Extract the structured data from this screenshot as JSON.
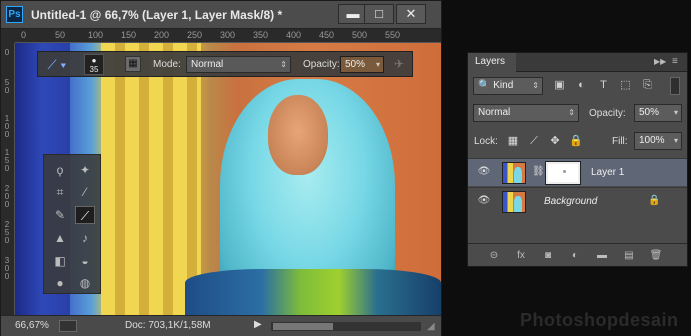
{
  "document": {
    "title": "Untitled-1 @ 66,7% (Layer 1, Layer Mask/8) *",
    "app_icon": "Ps",
    "window_controls": {
      "minimize": "▬",
      "maximize": "□",
      "close": "✕"
    },
    "ruler_top": [
      "0",
      "50",
      "100",
      "150",
      "200",
      "250",
      "300",
      "350",
      "400",
      "450",
      "500",
      "550"
    ],
    "ruler_left": [
      "0",
      "5 0",
      "1 0 0",
      "1 5 0",
      "2 0 0",
      "2 5 0",
      "3 0 0"
    ],
    "status": {
      "zoom": "66,67%",
      "doc": "Doc: 703,1K/1,58M",
      "arrow": "▶"
    }
  },
  "options_bar": {
    "brush_size": "35",
    "mode_label": "Mode:",
    "mode_value": "Normal",
    "opacity_label": "Opacity:",
    "opacity_value": "50%"
  },
  "layers_panel": {
    "tab_label": "Layers",
    "kind_value": "Kind",
    "blend_value": "Normal",
    "opacity_label": "Opacity:",
    "opacity_value": "50%",
    "lock_label": "Lock:",
    "fill_label": "Fill:",
    "fill_value": "100%",
    "layers": [
      {
        "name": "Layer 1",
        "selected": true
      },
      {
        "name": "Background",
        "selected": false
      }
    ]
  },
  "watermark": "Photoshopdesain",
  "colors": {
    "accent": "#31a8ff",
    "selected_row": "#5f6676",
    "panel": "#4b4b4b"
  },
  "icons": [
    "ps-logo-icon",
    "brush-icon",
    "lasso-icon",
    "magic-wand-icon",
    "crop-icon",
    "eyedropper-icon",
    "healing-icon",
    "stamp-icon",
    "history-brush-icon",
    "eraser-icon",
    "gradient-icon",
    "blur-icon",
    "eye-icon",
    "chain-icon",
    "lock-icon",
    "link-icon",
    "fx-icon",
    "mask-icon",
    "adjustment-icon",
    "folder-icon",
    "new-layer-icon",
    "trash-icon"
  ]
}
